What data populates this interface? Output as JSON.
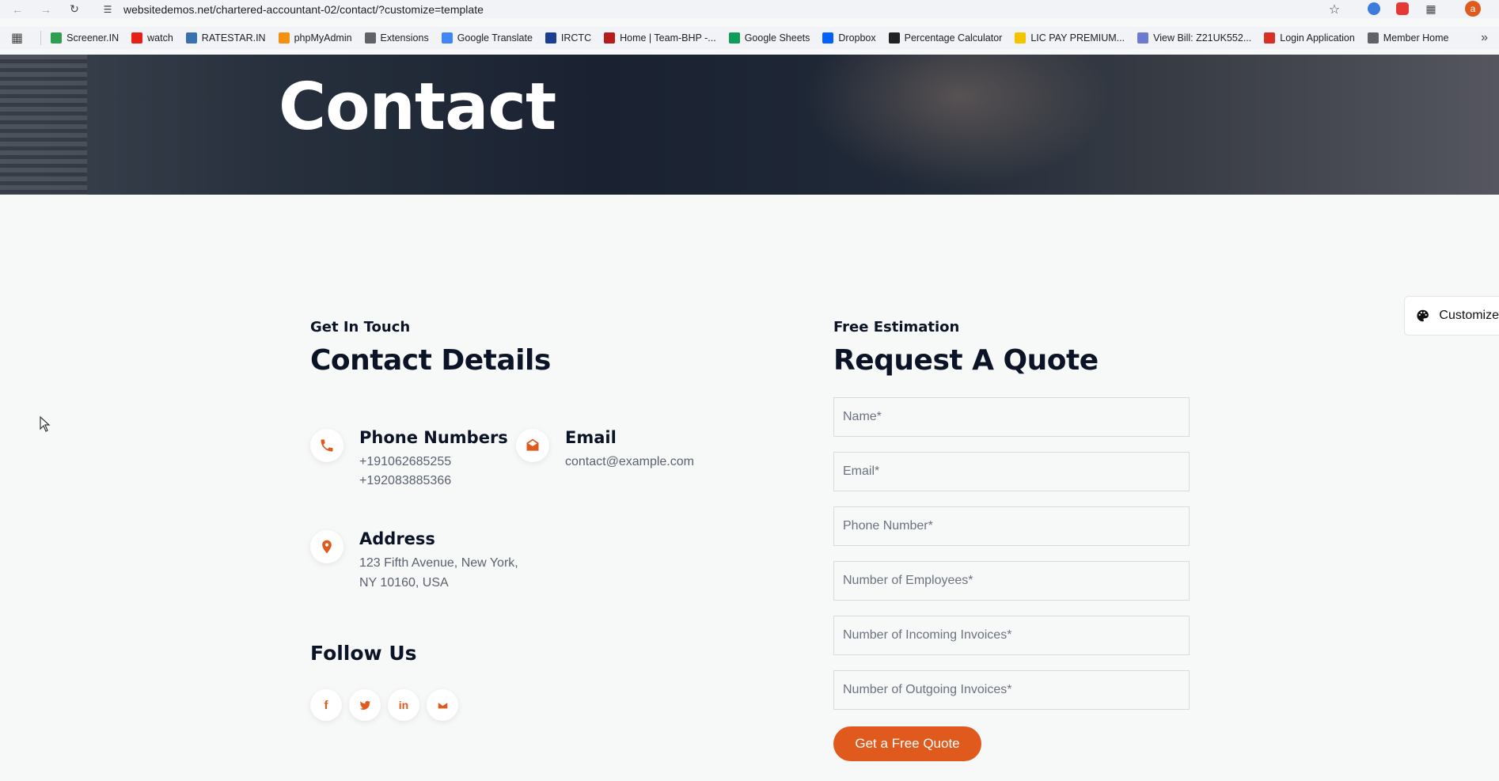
{
  "browser": {
    "url": "websitedemos.net/chartered-accountant-02/contact/?customize=template",
    "bookmarks": [
      {
        "label": "Screener.IN",
        "color": "#2e9e4f"
      },
      {
        "label": "watch",
        "color": "#e62117"
      },
      {
        "label": "RATESTAR.IN",
        "color": "#3a6fb0"
      },
      {
        "label": "phpMyAdmin",
        "color": "#f29111"
      },
      {
        "label": "Extensions",
        "color": "#5f6368"
      },
      {
        "label": "Google Translate",
        "color": "#4285f4"
      },
      {
        "label": "IRCTC",
        "color": "#1c3f95"
      },
      {
        "label": "Home | Team-BHP -...",
        "color": "#b71c1c"
      },
      {
        "label": "Google Sheets",
        "color": "#0f9d58"
      },
      {
        "label": "Dropbox",
        "color": "#0061ff"
      },
      {
        "label": "Percentage Calculator",
        "color": "#222222"
      },
      {
        "label": "LIC PAY PREMIUM...",
        "color": "#f5c400"
      },
      {
        "label": "View Bill: Z21UK552...",
        "color": "#6a7bd1"
      },
      {
        "label": "Login Application",
        "color": "#d93025"
      },
      {
        "label": "Member Home",
        "color": "#5f6368"
      }
    ],
    "more": "»"
  },
  "hero": {
    "title": "Contact"
  },
  "contact": {
    "subtitle": "Get In Touch",
    "heading": "Contact Details",
    "phone": {
      "title": "Phone Numbers",
      "line1": "+191062685255",
      "line2": "+192083885366"
    },
    "email": {
      "title": "Email",
      "value": "contact@example.com"
    },
    "address": {
      "title": "Address",
      "line1": "123 Fifth Avenue, New York,",
      "line2": "NY 10160, USA"
    },
    "follow": "Follow Us",
    "social": [
      "f",
      "t",
      "in",
      "m"
    ]
  },
  "quote": {
    "subtitle": "Free Estimation",
    "heading": "Request A Quote",
    "placeholders": {
      "name": "Name*",
      "email": "Email*",
      "phone": "Phone Number*",
      "employees": "Number of Employees*",
      "incoming": "Number of Incoming Invoices*",
      "outgoing": "Number of Outgoing Invoices*"
    },
    "button": "Get a Free Quote"
  },
  "customize": {
    "label": "Customize"
  },
  "accent_color": "#e05a1e"
}
